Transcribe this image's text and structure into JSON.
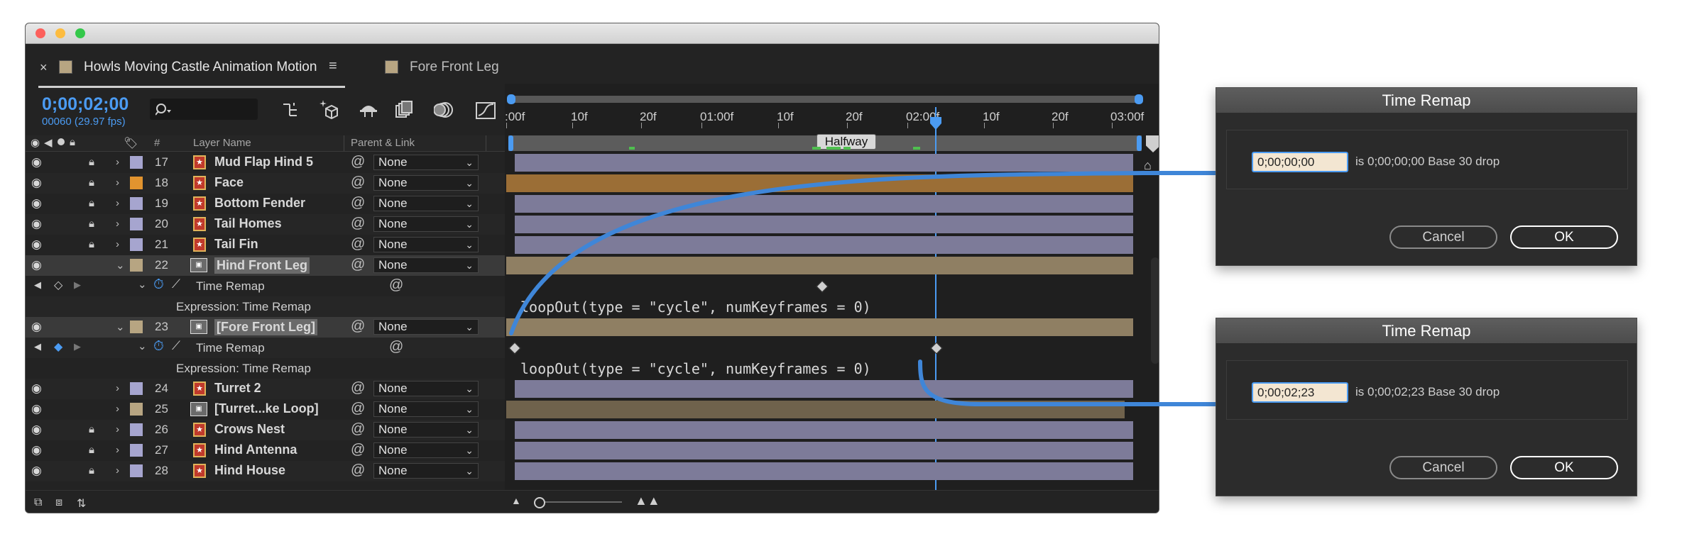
{
  "window": {
    "tabs": [
      {
        "label": "Howls Moving Castle Animation Motion",
        "close": "×",
        "menu": "≡",
        "active": true
      },
      {
        "label": "Fore Front Leg",
        "active": false
      }
    ]
  },
  "timecode": "0;00;02;00",
  "frame_info": "00060 (29.97 fps)",
  "search": {
    "placeholder": "",
    "icon": "search-icon"
  },
  "headers": {
    "number": "#",
    "layer_name": "Layer Name",
    "parent_link": "Parent & Link"
  },
  "ruler": {
    "labels": [
      ":00f",
      "10f",
      "20f",
      "01:00f",
      "10f",
      "20f",
      "02:00f",
      "10f",
      "20f",
      "03:00f"
    ],
    "marker": "Halfway"
  },
  "rows": [
    {
      "kind": "layer",
      "num": "17",
      "name": "Mud Flap Hind 5",
      "parent": "None",
      "color": "#a6a5cf",
      "type": "shape",
      "locked": true,
      "bar": "#7d7b99"
    },
    {
      "kind": "layer",
      "num": "18",
      "name": "Face",
      "parent": "None",
      "color": "#e2942f",
      "type": "shape",
      "locked": true,
      "bar": "#9b6e36"
    },
    {
      "kind": "layer",
      "num": "19",
      "name": "Bottom Fender",
      "parent": "None",
      "color": "#a6a5cf",
      "type": "shape",
      "locked": true,
      "bar": "#7d7b99"
    },
    {
      "kind": "layer",
      "num": "20",
      "name": "Tail Homes",
      "parent": "None",
      "color": "#a6a5cf",
      "type": "shape",
      "locked": true,
      "bar": "#7d7b99"
    },
    {
      "kind": "layer",
      "num": "21",
      "name": "Tail Fin",
      "parent": "None",
      "color": "#a6a5cf",
      "type": "shape",
      "locked": true,
      "bar": "#7d7b99"
    },
    {
      "kind": "layer",
      "num": "22",
      "name": "Hind Front Leg",
      "parent": "None",
      "color": "#b7a582",
      "type": "precomp",
      "locked": false,
      "selected": true,
      "bar": "#8f7f63"
    },
    {
      "kind": "prop",
      "label": "Time Remap"
    },
    {
      "kind": "expr",
      "label": "Expression: Time Remap",
      "code": "loopOut(type = \"cycle\", numKeyframes = 0)"
    },
    {
      "kind": "layer",
      "num": "23",
      "name": "[Fore Front Leg]",
      "parent": "None",
      "color": "#b7a582",
      "type": "precomp",
      "locked": false,
      "selected": true,
      "bar": "#8f7f63"
    },
    {
      "kind": "prop",
      "label": "Time Remap"
    },
    {
      "kind": "expr",
      "label": "Expression: Time Remap",
      "code": "loopOut(type = \"cycle\", numKeyframes = 0)"
    },
    {
      "kind": "layer",
      "num": "24",
      "name": "Turret 2",
      "parent": "None",
      "color": "#a6a5cf",
      "type": "shape",
      "locked": false,
      "bar": "#7d7b99"
    },
    {
      "kind": "layer",
      "num": "25",
      "name": "[Turret...ke Loop]",
      "parent": "None",
      "color": "#b7a582",
      "type": "precomp",
      "locked": false,
      "bar": "#6f624c"
    },
    {
      "kind": "layer",
      "num": "26",
      "name": "Crows Nest",
      "parent": "None",
      "color": "#a6a5cf",
      "type": "shape",
      "locked": true,
      "bar": "#7d7b99"
    },
    {
      "kind": "layer",
      "num": "27",
      "name": "Hind Antenna",
      "parent": "None",
      "color": "#a6a5cf",
      "type": "shape",
      "locked": true,
      "bar": "#7d7b99"
    },
    {
      "kind": "layer",
      "num": "28",
      "name": "Hind House",
      "parent": "None",
      "color": "#a6a5cf",
      "type": "shape",
      "locked": true,
      "bar": "#7d7b99"
    }
  ],
  "dialogs": [
    {
      "title": "Time Remap",
      "value": "0;00;00;00",
      "info": "is 0;00;00;00  Base 30  drop",
      "cancel": "Cancel",
      "ok": "OK"
    },
    {
      "title": "Time Remap",
      "value": "0;00;02;23",
      "info": "is 0;00;02;23  Base 30  drop",
      "cancel": "Cancel",
      "ok": "OK"
    }
  ],
  "colors": {
    "accent": "#4b9bf2",
    "panel": "#232323",
    "callout": "#3f86d8"
  }
}
